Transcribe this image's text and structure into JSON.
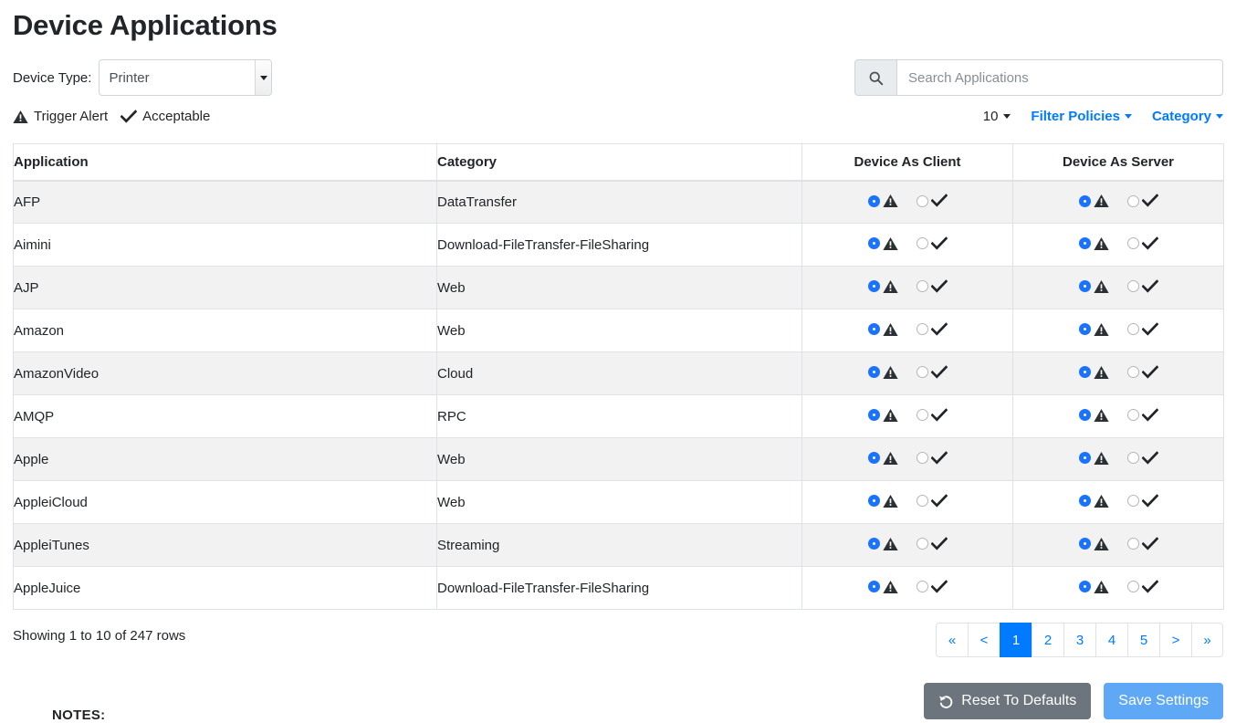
{
  "page_title": "Device Applications",
  "device_type": {
    "label": "Device Type:",
    "selected": "Printer",
    "options": [
      "Printer"
    ]
  },
  "search": {
    "placeholder": "Search Applications",
    "value": "",
    "icon": "search-icon"
  },
  "legend": [
    {
      "icon": "warning-triangle-icon",
      "label": "Trigger Alert"
    },
    {
      "icon": "check-icon",
      "label": "Acceptable"
    }
  ],
  "toolbar": {
    "page_size": "10",
    "filter_policies_label": "Filter Policies",
    "category_label": "Category"
  },
  "table": {
    "headers": {
      "application": "Application",
      "category": "Category",
      "device_as_client": "Device As Client",
      "device_as_server": "Device As Server"
    },
    "rows": [
      {
        "application": "AFP",
        "category": "DataTransfer",
        "client": "alert",
        "server": "alert"
      },
      {
        "application": "Aimini",
        "category": "Download-FileTransfer-FileSharing",
        "client": "alert",
        "server": "alert"
      },
      {
        "application": "AJP",
        "category": "Web",
        "client": "alert",
        "server": "alert"
      },
      {
        "application": "Amazon",
        "category": "Web",
        "client": "alert",
        "server": "alert"
      },
      {
        "application": "AmazonVideo",
        "category": "Cloud",
        "client": "alert",
        "server": "alert"
      },
      {
        "application": "AMQP",
        "category": "RPC",
        "client": "alert",
        "server": "alert"
      },
      {
        "application": "Apple",
        "category": "Web",
        "client": "alert",
        "server": "alert"
      },
      {
        "application": "AppleiCloud",
        "category": "Web",
        "client": "alert",
        "server": "alert"
      },
      {
        "application": "AppleiTunes",
        "category": "Streaming",
        "client": "alert",
        "server": "alert"
      },
      {
        "application": "AppleJuice",
        "category": "Download-FileTransfer-FileSharing",
        "client": "alert",
        "server": "alert"
      }
    ]
  },
  "footer": {
    "showing_text": "Showing 1 to 10 of 247 rows",
    "pagination": [
      {
        "label": "«",
        "name": "first",
        "active": false
      },
      {
        "label": "<",
        "name": "prev",
        "active": false
      },
      {
        "label": "1",
        "name": "page-1",
        "active": true
      },
      {
        "label": "2",
        "name": "page-2",
        "active": false
      },
      {
        "label": "3",
        "name": "page-3",
        "active": false
      },
      {
        "label": "4",
        "name": "page-4",
        "active": false
      },
      {
        "label": "5",
        "name": "page-5",
        "active": false
      },
      {
        "label": ">",
        "name": "next",
        "active": false
      },
      {
        "label": "»",
        "name": "last",
        "active": false
      }
    ]
  },
  "actions": {
    "reset_label": "Reset To Defaults",
    "reset_icon": "undo-arrow-icon",
    "save_label": "Save Settings"
  },
  "notes_label": "NOTES:",
  "colors": {
    "accent_blue": "#007bff",
    "radio_blue": "#1a73ff",
    "save_blue": "#5fa8f5",
    "reset_gray": "#6c757d",
    "row_stripe": "#f2f2f2",
    "border": "#dee2e6"
  }
}
